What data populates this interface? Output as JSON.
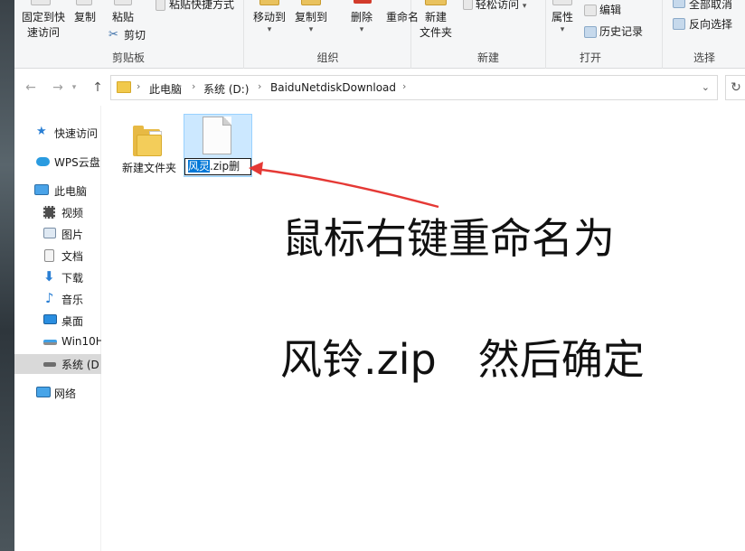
{
  "ribbon": {
    "clipboard": {
      "pin_label_1": "固定到快",
      "pin_label_2": "速访问",
      "copy_label": "复制",
      "paste_label": "粘贴",
      "paste_shortcut_label": "粘贴快捷方式",
      "cut_label": "剪切",
      "group_label": "剪贴板"
    },
    "organize": {
      "move_to_label": "移动到",
      "copy_to_label": "复制到",
      "delete_label": "删除",
      "rename_label": "重命名",
      "group_label": "组织"
    },
    "new": {
      "new_folder_label_1": "新建",
      "new_folder_label_2": "文件夹",
      "easy_access_label": "轻松访问",
      "group_label": "新建"
    },
    "open": {
      "properties_label": "属性",
      "edit_label": "编辑",
      "history_label": "历史记录",
      "group_label": "打开"
    },
    "select": {
      "select_none_label": "全部取消",
      "invert_label": "反向选择",
      "group_label": "选择"
    }
  },
  "address": {
    "crumbs": [
      "此电脑",
      "系统 (D:)",
      "BaiduNetdiskDownload"
    ]
  },
  "nav": {
    "items": [
      {
        "label": "快速访问",
        "icon": "star-icon"
      },
      {
        "label": "WPS云盘",
        "icon": "cloud-icon"
      },
      {
        "label": "此电脑",
        "icon": "computer-icon"
      },
      {
        "label": "视频",
        "icon": "video-icon"
      },
      {
        "label": "图片",
        "icon": "picture-icon"
      },
      {
        "label": "文档",
        "icon": "document-icon"
      },
      {
        "label": "下载",
        "icon": "download-icon"
      },
      {
        "label": "音乐",
        "icon": "music-icon"
      },
      {
        "label": "桌面",
        "icon": "desktop-icon"
      },
      {
        "label": "Win10H",
        "icon": "network-drive-icon"
      },
      {
        "label": "系统 (D",
        "icon": "drive-icon"
      },
      {
        "label": "网络",
        "icon": "network-icon"
      }
    ]
  },
  "files": {
    "folder_name": "新建文件夹",
    "rename_selected": "风灵",
    "rename_rest": ".zip删"
  },
  "annotation": {
    "line1": "鼠标右键重命名为",
    "line2": "风铃.zip　然后确定",
    "arrow_color": "#e53935"
  },
  "colors": {
    "selection_blue": "#cce8ff",
    "rename_highlight": "#0078d7",
    "delete_red": "#d23b2b"
  }
}
